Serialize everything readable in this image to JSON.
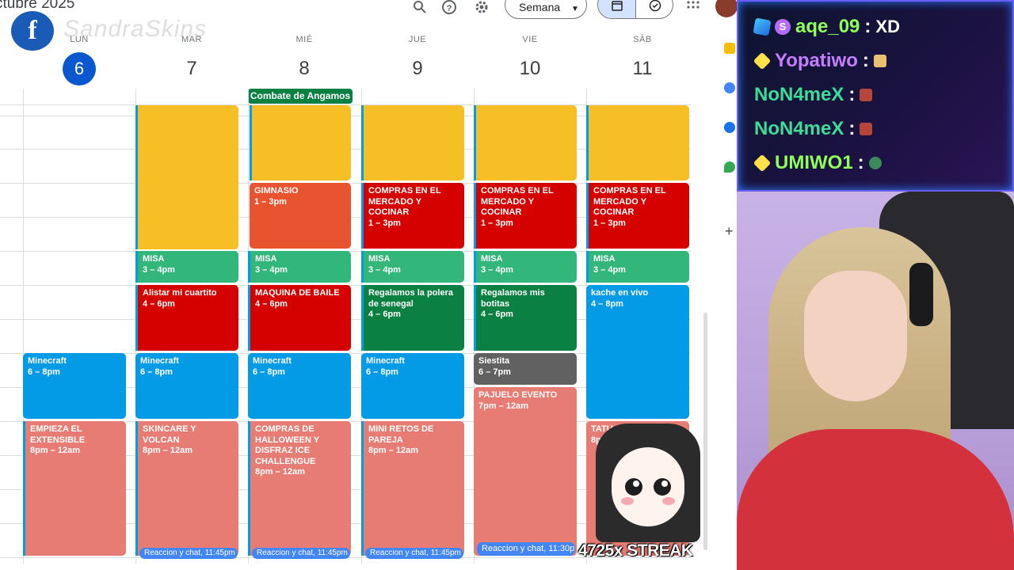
{
  "header": {
    "title": "ctubre 2025",
    "view_label": "Semana",
    "icons": [
      "search-icon",
      "help-icon",
      "settings-icon",
      "calendar-icon",
      "tasks-icon",
      "apps-icon"
    ]
  },
  "watermark": {
    "logo": "f",
    "name": "SandraSkins"
  },
  "days": [
    {
      "name": "LUN",
      "num": "6"
    },
    {
      "name": "MAR",
      "num": "7"
    },
    {
      "name": "MIÉ",
      "num": "8"
    },
    {
      "name": "JUE",
      "num": "9"
    },
    {
      "name": "VIE",
      "num": "10"
    },
    {
      "name": "SÁB",
      "num": "11"
    }
  ],
  "all_day": {
    "title": "Combate de Angamos"
  },
  "events": {
    "gym": {
      "title": "GIMNASIO",
      "time": "1 – 3pm"
    },
    "compras_jue": {
      "title": "COMPRAS EN EL MERCADO Y COCINAR",
      "time": "1 – 3pm"
    },
    "compras_vie": {
      "title": "COMPRAS EN EL MERCADO Y COCINAR",
      "time": "1 – 3pm"
    },
    "compras_sab": {
      "title": "COMPRAS EN EL MERCADO Y COCINAR",
      "time": "1 – 3pm"
    },
    "misa_mar": {
      "title": "MISA",
      "time": "3 – 4pm"
    },
    "misa_mie": {
      "title": "MISA",
      "time": "3 – 4pm"
    },
    "misa_jue": {
      "title": "MISA",
      "time": "3 – 4pm"
    },
    "misa_vie": {
      "title": "MISA",
      "time": "3 – 4pm"
    },
    "misa_sab": {
      "title": "MISA",
      "time": "3 – 4pm"
    },
    "alistar": {
      "title": "Alistar mi cuartito",
      "time": "4 – 6pm"
    },
    "maquina": {
      "title": "MAQUINA DE BAILE",
      "time": "4 – 6pm"
    },
    "polera": {
      "title": "Regalamos la polera de senegal",
      "time": "4 – 6pm"
    },
    "botitas": {
      "title": "Regalamos mis botitas",
      "time": "4 – 6pm"
    },
    "kache": {
      "title": "kache en vivo",
      "time": "4 – 8pm"
    },
    "mc_lun": {
      "title": "Minecraft",
      "time": "6 – 8pm"
    },
    "mc_mar": {
      "title": "Minecraft",
      "time": "6 – 8pm"
    },
    "mc_mie": {
      "title": "Minecraft",
      "time": "6 – 8pm"
    },
    "mc_jue": {
      "title": "Minecraft",
      "time": "6 – 8pm"
    },
    "siestita": {
      "title": "Siestita",
      "time": "6 – 7pm"
    },
    "pajuelo": {
      "title": "PAJUELO EVENTO",
      "time": "7pm – 12am"
    },
    "extensible": {
      "title": "EMPIEZA EL EXTENSIBLE",
      "time": "8pm – 12am"
    },
    "skincare": {
      "title": "SKINCARE Y VOLCAN",
      "time": "8pm – 12am"
    },
    "halloween": {
      "title": "COMPRAS DE HALLOWEEN Y DISFRAZ ICE CHALLENGUE",
      "time": "8pm – 12am"
    },
    "retos": {
      "title": "MINI RETOS DE PAREJA",
      "time": "8pm – 12am"
    },
    "tatu": {
      "title": "TATU",
      "time": "8p"
    }
  },
  "chips": {
    "mar": "Reaccion y chat, 11:45pm",
    "mie": "Reaccion y chat, 11:45pm",
    "jue": "Reaccion y chat, 11:45pm",
    "vie": "Reaccion y chat, 11:30p"
  },
  "chat": [
    {
      "user": "aqe_09",
      "text": "XD",
      "color": "#8fff5a"
    },
    {
      "user": "Yopatiwo",
      "text": "",
      "color": "#c77dff"
    },
    {
      "user": "NoN4meX",
      "text": "",
      "color": "#3ddc97"
    },
    {
      "user": "NoN4meX",
      "text": "",
      "color": "#3ddc97"
    },
    {
      "user": "UMIWO1",
      "text": "",
      "color": "#8fff5a"
    }
  ],
  "streak": "4725x STREAK",
  "colors": {
    "today": "#0b57d0",
    "chat_border": "#6b5cff"
  }
}
